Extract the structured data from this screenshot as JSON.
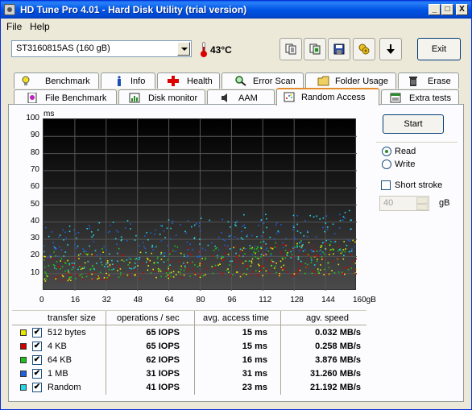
{
  "window": {
    "title": "HD Tune Pro 4.01 - Hard Disk Utility (trial version)",
    "controls": [
      "_",
      "□",
      "X"
    ]
  },
  "menu": [
    "File",
    "Help"
  ],
  "toolbar": {
    "drive": "ST3160815AS (160 gB)",
    "temperature": "43°C",
    "exit_label": "Exit",
    "icons": [
      "copy-text-icon",
      "copy-screenshot-icon",
      "save-icon",
      "options-icon",
      "download-icon"
    ]
  },
  "tabs_top": [
    {
      "label": "Benchmark",
      "icon": "lightbulb-icon"
    },
    {
      "label": "Info",
      "icon": "info-icon"
    },
    {
      "label": "Health",
      "icon": "health-cross-icon"
    },
    {
      "label": "Error Scan",
      "icon": "magnifier-icon"
    },
    {
      "label": "Folder Usage",
      "icon": "folder-icon"
    },
    {
      "label": "Erase",
      "icon": "trash-icon"
    }
  ],
  "tabs_bottom": [
    {
      "label": "File Benchmark",
      "icon": "file-benchmark-icon"
    },
    {
      "label": "Disk monitor",
      "icon": "disk-monitor-icon"
    },
    {
      "label": "AAM",
      "icon": "speaker-icon"
    },
    {
      "label": "Random Access",
      "icon": "random-access-icon",
      "active": true
    },
    {
      "label": "Extra tests",
      "icon": "extra-tests-icon"
    }
  ],
  "controls": {
    "start_label": "Start",
    "read_label": "Read",
    "write_label": "Write",
    "mode": "Read",
    "short_stroke_label": "Short stroke",
    "short_stroke_checked": false,
    "short_stroke_value": "40",
    "short_stroke_unit": "gB"
  },
  "results": {
    "headers": [
      "transfer size",
      "operations / sec",
      "avg. access time",
      "agv. speed"
    ],
    "rows": [
      {
        "size": "512 bytes",
        "color": "#e8e800",
        "checked": true,
        "ops": "65 IOPS",
        "access": "15 ms",
        "speed": "0.032 MB/s"
      },
      {
        "size": "4 KB",
        "color": "#d00000",
        "checked": true,
        "ops": "65 IOPS",
        "access": "15 ms",
        "speed": "0.258 MB/s"
      },
      {
        "size": "64 KB",
        "color": "#20c020",
        "checked": true,
        "ops": "62 IOPS",
        "access": "16 ms",
        "speed": "3.876 MB/s"
      },
      {
        "size": "1 MB",
        "color": "#2060e0",
        "checked": true,
        "ops": "31 IOPS",
        "access": "31 ms",
        "speed": "31.260 MB/s"
      },
      {
        "size": "Random",
        "color": "#20d8e8",
        "checked": true,
        "ops": "41 IOPS",
        "access": "23 ms",
        "speed": "21.192 MB/s"
      }
    ]
  },
  "chart_data": {
    "type": "scatter",
    "ylabel": "ms",
    "y_ticks": [
      "100",
      "90",
      "80",
      "70",
      "60",
      "50",
      "40",
      "30",
      "20",
      "10"
    ],
    "x_ticks": [
      "0",
      "16",
      "32",
      "48",
      "64",
      "80",
      "96",
      "112",
      "128",
      "144",
      "160gB"
    ],
    "ylim": [
      0,
      100
    ],
    "xlim": [
      0,
      160
    ],
    "series": [
      {
        "name": "512 bytes",
        "color": "#e8e800",
        "band": [
          6,
          22
        ]
      },
      {
        "name": "4 KB",
        "color": "#d00000",
        "band": [
          6,
          22
        ]
      },
      {
        "name": "64 KB",
        "color": "#20c020",
        "band": [
          7,
          24
        ]
      },
      {
        "name": "1 MB",
        "color": "#2060e0",
        "band": [
          18,
          38
        ]
      },
      {
        "name": "Random",
        "color": "#20d8e8",
        "band": [
          12,
          40
        ]
      }
    ]
  }
}
